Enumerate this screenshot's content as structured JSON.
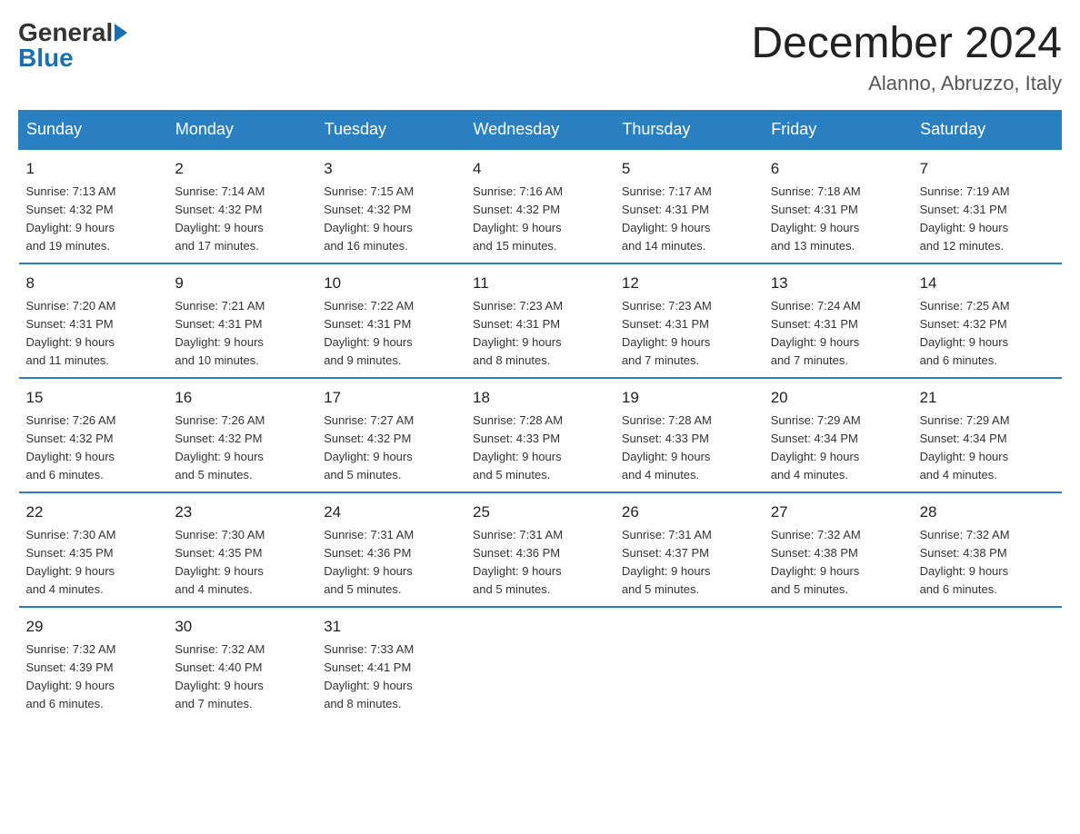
{
  "header": {
    "logo_general": "General",
    "logo_blue": "Blue",
    "month_title": "December 2024",
    "location": "Alanno, Abruzzo, Italy"
  },
  "weekdays": [
    "Sunday",
    "Monday",
    "Tuesday",
    "Wednesday",
    "Thursday",
    "Friday",
    "Saturday"
  ],
  "weeks": [
    [
      {
        "day": "1",
        "sunrise": "7:13 AM",
        "sunset": "4:32 PM",
        "daylight": "9 hours and 19 minutes."
      },
      {
        "day": "2",
        "sunrise": "7:14 AM",
        "sunset": "4:32 PM",
        "daylight": "9 hours and 17 minutes."
      },
      {
        "day": "3",
        "sunrise": "7:15 AM",
        "sunset": "4:32 PM",
        "daylight": "9 hours and 16 minutes."
      },
      {
        "day": "4",
        "sunrise": "7:16 AM",
        "sunset": "4:32 PM",
        "daylight": "9 hours and 15 minutes."
      },
      {
        "day": "5",
        "sunrise": "7:17 AM",
        "sunset": "4:31 PM",
        "daylight": "9 hours and 14 minutes."
      },
      {
        "day": "6",
        "sunrise": "7:18 AM",
        "sunset": "4:31 PM",
        "daylight": "9 hours and 13 minutes."
      },
      {
        "day": "7",
        "sunrise": "7:19 AM",
        "sunset": "4:31 PM",
        "daylight": "9 hours and 12 minutes."
      }
    ],
    [
      {
        "day": "8",
        "sunrise": "7:20 AM",
        "sunset": "4:31 PM",
        "daylight": "9 hours and 11 minutes."
      },
      {
        "day": "9",
        "sunrise": "7:21 AM",
        "sunset": "4:31 PM",
        "daylight": "9 hours and 10 minutes."
      },
      {
        "day": "10",
        "sunrise": "7:22 AM",
        "sunset": "4:31 PM",
        "daylight": "9 hours and 9 minutes."
      },
      {
        "day": "11",
        "sunrise": "7:23 AM",
        "sunset": "4:31 PM",
        "daylight": "9 hours and 8 minutes."
      },
      {
        "day": "12",
        "sunrise": "7:23 AM",
        "sunset": "4:31 PM",
        "daylight": "9 hours and 7 minutes."
      },
      {
        "day": "13",
        "sunrise": "7:24 AM",
        "sunset": "4:31 PM",
        "daylight": "9 hours and 7 minutes."
      },
      {
        "day": "14",
        "sunrise": "7:25 AM",
        "sunset": "4:32 PM",
        "daylight": "9 hours and 6 minutes."
      }
    ],
    [
      {
        "day": "15",
        "sunrise": "7:26 AM",
        "sunset": "4:32 PM",
        "daylight": "9 hours and 6 minutes."
      },
      {
        "day": "16",
        "sunrise": "7:26 AM",
        "sunset": "4:32 PM",
        "daylight": "9 hours and 5 minutes."
      },
      {
        "day": "17",
        "sunrise": "7:27 AM",
        "sunset": "4:32 PM",
        "daylight": "9 hours and 5 minutes."
      },
      {
        "day": "18",
        "sunrise": "7:28 AM",
        "sunset": "4:33 PM",
        "daylight": "9 hours and 5 minutes."
      },
      {
        "day": "19",
        "sunrise": "7:28 AM",
        "sunset": "4:33 PM",
        "daylight": "9 hours and 4 minutes."
      },
      {
        "day": "20",
        "sunrise": "7:29 AM",
        "sunset": "4:34 PM",
        "daylight": "9 hours and 4 minutes."
      },
      {
        "day": "21",
        "sunrise": "7:29 AM",
        "sunset": "4:34 PM",
        "daylight": "9 hours and 4 minutes."
      }
    ],
    [
      {
        "day": "22",
        "sunrise": "7:30 AM",
        "sunset": "4:35 PM",
        "daylight": "9 hours and 4 minutes."
      },
      {
        "day": "23",
        "sunrise": "7:30 AM",
        "sunset": "4:35 PM",
        "daylight": "9 hours and 4 minutes."
      },
      {
        "day": "24",
        "sunrise": "7:31 AM",
        "sunset": "4:36 PM",
        "daylight": "9 hours and 5 minutes."
      },
      {
        "day": "25",
        "sunrise": "7:31 AM",
        "sunset": "4:36 PM",
        "daylight": "9 hours and 5 minutes."
      },
      {
        "day": "26",
        "sunrise": "7:31 AM",
        "sunset": "4:37 PM",
        "daylight": "9 hours and 5 minutes."
      },
      {
        "day": "27",
        "sunrise": "7:32 AM",
        "sunset": "4:38 PM",
        "daylight": "9 hours and 5 minutes."
      },
      {
        "day": "28",
        "sunrise": "7:32 AM",
        "sunset": "4:38 PM",
        "daylight": "9 hours and 6 minutes."
      }
    ],
    [
      {
        "day": "29",
        "sunrise": "7:32 AM",
        "sunset": "4:39 PM",
        "daylight": "9 hours and 6 minutes."
      },
      {
        "day": "30",
        "sunrise": "7:32 AM",
        "sunset": "4:40 PM",
        "daylight": "9 hours and 7 minutes."
      },
      {
        "day": "31",
        "sunrise": "7:33 AM",
        "sunset": "4:41 PM",
        "daylight": "9 hours and 8 minutes."
      },
      null,
      null,
      null,
      null
    ]
  ],
  "labels": {
    "sunrise": "Sunrise:",
    "sunset": "Sunset:",
    "daylight": "Daylight:"
  }
}
